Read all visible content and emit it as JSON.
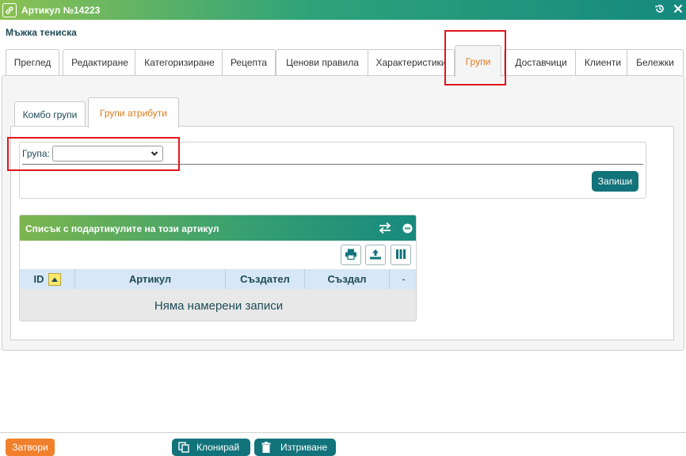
{
  "window": {
    "title": "Артикул №14223"
  },
  "product": {
    "name": "Мъжка тениска"
  },
  "tabs": [
    {
      "label": "Преглед"
    },
    {
      "label": "Редактиране"
    },
    {
      "label": "Категоризиране"
    },
    {
      "label": "Рецепта"
    },
    {
      "label": "Ценови правила"
    },
    {
      "label": "Характеристики"
    },
    {
      "label": "Групи"
    },
    {
      "label": "Доставчици"
    },
    {
      "label": "Клиенти"
    },
    {
      "label": "Бележки"
    }
  ],
  "subtabs": [
    {
      "label": "Комбо групи"
    },
    {
      "label": "Групи атрибути"
    }
  ],
  "form": {
    "group_label": "Група:",
    "group_value": "",
    "save_label": "Запиши"
  },
  "grid": {
    "title": "Списък с подартикулите на този артикул",
    "columns": [
      "ID",
      "Артикул",
      "Създател",
      "Създал",
      "-"
    ],
    "empty_text": "Няма намерени записи"
  },
  "footer": {
    "close_label": "Затвори",
    "clone_label": "Клонирай",
    "delete_label": "Изтриване"
  },
  "colors": {
    "accent_teal": "#12737b",
    "active_tab": "#e07b1a",
    "close_button": "#f0802c",
    "highlight": "#e0161f"
  }
}
